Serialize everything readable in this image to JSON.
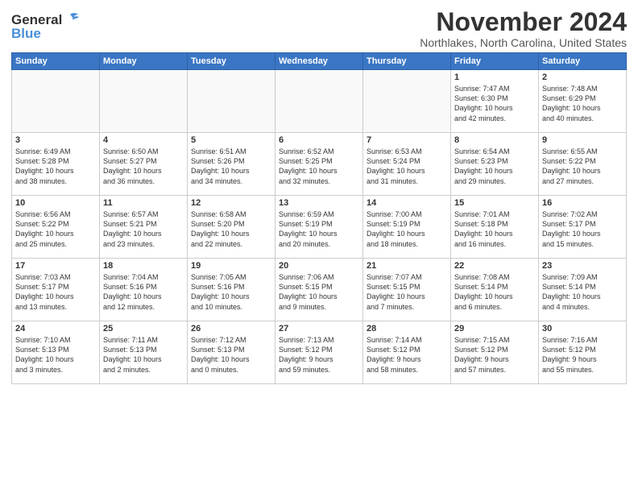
{
  "header": {
    "logo_general": "General",
    "logo_blue": "Blue",
    "month": "November 2024",
    "location": "Northlakes, North Carolina, United States"
  },
  "days_of_week": [
    "Sunday",
    "Monday",
    "Tuesday",
    "Wednesday",
    "Thursday",
    "Friday",
    "Saturday"
  ],
  "weeks": [
    [
      {
        "day": "",
        "info": ""
      },
      {
        "day": "",
        "info": ""
      },
      {
        "day": "",
        "info": ""
      },
      {
        "day": "",
        "info": ""
      },
      {
        "day": "",
        "info": ""
      },
      {
        "day": "1",
        "info": "Sunrise: 7:47 AM\nSunset: 6:30 PM\nDaylight: 10 hours\nand 42 minutes."
      },
      {
        "day": "2",
        "info": "Sunrise: 7:48 AM\nSunset: 6:29 PM\nDaylight: 10 hours\nand 40 minutes."
      }
    ],
    [
      {
        "day": "3",
        "info": "Sunrise: 6:49 AM\nSunset: 5:28 PM\nDaylight: 10 hours\nand 38 minutes."
      },
      {
        "day": "4",
        "info": "Sunrise: 6:50 AM\nSunset: 5:27 PM\nDaylight: 10 hours\nand 36 minutes."
      },
      {
        "day": "5",
        "info": "Sunrise: 6:51 AM\nSunset: 5:26 PM\nDaylight: 10 hours\nand 34 minutes."
      },
      {
        "day": "6",
        "info": "Sunrise: 6:52 AM\nSunset: 5:25 PM\nDaylight: 10 hours\nand 32 minutes."
      },
      {
        "day": "7",
        "info": "Sunrise: 6:53 AM\nSunset: 5:24 PM\nDaylight: 10 hours\nand 31 minutes."
      },
      {
        "day": "8",
        "info": "Sunrise: 6:54 AM\nSunset: 5:23 PM\nDaylight: 10 hours\nand 29 minutes."
      },
      {
        "day": "9",
        "info": "Sunrise: 6:55 AM\nSunset: 5:22 PM\nDaylight: 10 hours\nand 27 minutes."
      }
    ],
    [
      {
        "day": "10",
        "info": "Sunrise: 6:56 AM\nSunset: 5:22 PM\nDaylight: 10 hours\nand 25 minutes."
      },
      {
        "day": "11",
        "info": "Sunrise: 6:57 AM\nSunset: 5:21 PM\nDaylight: 10 hours\nand 23 minutes."
      },
      {
        "day": "12",
        "info": "Sunrise: 6:58 AM\nSunset: 5:20 PM\nDaylight: 10 hours\nand 22 minutes."
      },
      {
        "day": "13",
        "info": "Sunrise: 6:59 AM\nSunset: 5:19 PM\nDaylight: 10 hours\nand 20 minutes."
      },
      {
        "day": "14",
        "info": "Sunrise: 7:00 AM\nSunset: 5:19 PM\nDaylight: 10 hours\nand 18 minutes."
      },
      {
        "day": "15",
        "info": "Sunrise: 7:01 AM\nSunset: 5:18 PM\nDaylight: 10 hours\nand 16 minutes."
      },
      {
        "day": "16",
        "info": "Sunrise: 7:02 AM\nSunset: 5:17 PM\nDaylight: 10 hours\nand 15 minutes."
      }
    ],
    [
      {
        "day": "17",
        "info": "Sunrise: 7:03 AM\nSunset: 5:17 PM\nDaylight: 10 hours\nand 13 minutes."
      },
      {
        "day": "18",
        "info": "Sunrise: 7:04 AM\nSunset: 5:16 PM\nDaylight: 10 hours\nand 12 minutes."
      },
      {
        "day": "19",
        "info": "Sunrise: 7:05 AM\nSunset: 5:16 PM\nDaylight: 10 hours\nand 10 minutes."
      },
      {
        "day": "20",
        "info": "Sunrise: 7:06 AM\nSunset: 5:15 PM\nDaylight: 10 hours\nand 9 minutes."
      },
      {
        "day": "21",
        "info": "Sunrise: 7:07 AM\nSunset: 5:15 PM\nDaylight: 10 hours\nand 7 minutes."
      },
      {
        "day": "22",
        "info": "Sunrise: 7:08 AM\nSunset: 5:14 PM\nDaylight: 10 hours\nand 6 minutes."
      },
      {
        "day": "23",
        "info": "Sunrise: 7:09 AM\nSunset: 5:14 PM\nDaylight: 10 hours\nand 4 minutes."
      }
    ],
    [
      {
        "day": "24",
        "info": "Sunrise: 7:10 AM\nSunset: 5:13 PM\nDaylight: 10 hours\nand 3 minutes."
      },
      {
        "day": "25",
        "info": "Sunrise: 7:11 AM\nSunset: 5:13 PM\nDaylight: 10 hours\nand 2 minutes."
      },
      {
        "day": "26",
        "info": "Sunrise: 7:12 AM\nSunset: 5:13 PM\nDaylight: 10 hours\nand 0 minutes."
      },
      {
        "day": "27",
        "info": "Sunrise: 7:13 AM\nSunset: 5:12 PM\nDaylight: 9 hours\nand 59 minutes."
      },
      {
        "day": "28",
        "info": "Sunrise: 7:14 AM\nSunset: 5:12 PM\nDaylight: 9 hours\nand 58 minutes."
      },
      {
        "day": "29",
        "info": "Sunrise: 7:15 AM\nSunset: 5:12 PM\nDaylight: 9 hours\nand 57 minutes."
      },
      {
        "day": "30",
        "info": "Sunrise: 7:16 AM\nSunset: 5:12 PM\nDaylight: 9 hours\nand 55 minutes."
      }
    ]
  ]
}
